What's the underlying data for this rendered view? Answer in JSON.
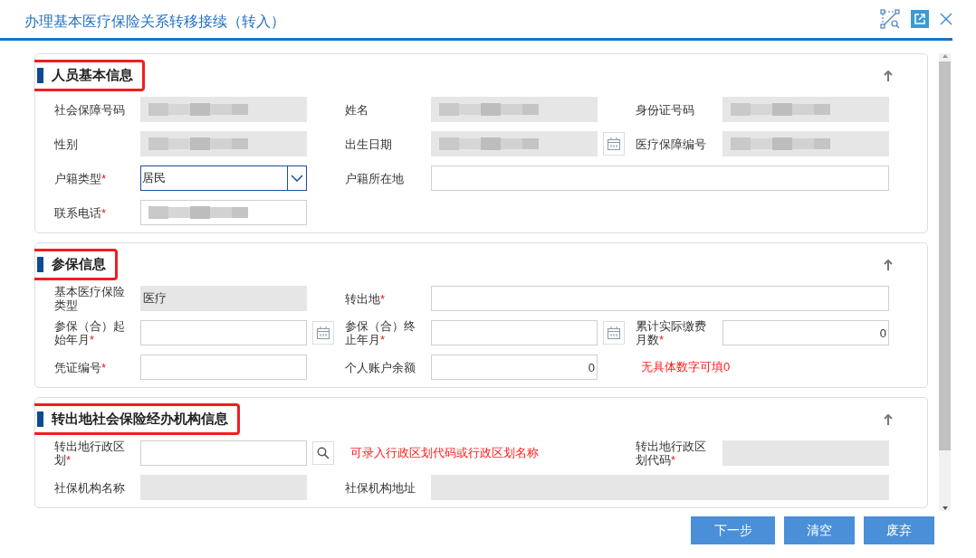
{
  "window": {
    "title": "办理基本医疗保险关系转移接续（转入）"
  },
  "sections": [
    {
      "title": "人员基本信息",
      "highlighted": true,
      "rows": [
        [
          {
            "kind": "label",
            "text": "社会保障号码"
          },
          {
            "kind": "input",
            "readonly": true,
            "redacted": true
          },
          {
            "kind": "spacer"
          },
          {
            "kind": "label",
            "text": "姓名"
          },
          {
            "kind": "input",
            "readonly": true,
            "redacted": true
          },
          {
            "kind": "spacer"
          },
          {
            "kind": "label",
            "text": "身份证号码"
          },
          {
            "kind": "input",
            "readonly": true,
            "redacted": true
          }
        ],
        [
          {
            "kind": "label",
            "text": "性别"
          },
          {
            "kind": "input",
            "readonly": true,
            "redacted": true
          },
          {
            "kind": "spacer"
          },
          {
            "kind": "label",
            "text": "出生日期"
          },
          {
            "kind": "input",
            "readonly": true,
            "redacted": true
          },
          {
            "kind": "calendar"
          },
          {
            "kind": "label",
            "text": "医疗保障编号"
          },
          {
            "kind": "input",
            "readonly": true,
            "redacted": true
          }
        ],
        [
          {
            "kind": "label",
            "text": "户籍类型",
            "star": "*"
          },
          {
            "kind": "select",
            "value": "居民"
          },
          {
            "kind": "spacer"
          },
          {
            "kind": "label",
            "text": "户籍所在地"
          },
          {
            "kind": "wide-input",
            "readonly": false
          }
        ],
        [
          {
            "kind": "label",
            "text": "联系电话",
            "star": "*"
          },
          {
            "kind": "input",
            "readonly": false,
            "redacted": true
          }
        ]
      ]
    },
    {
      "title": "参保信息",
      "highlighted": true,
      "rows": [
        [
          {
            "kind": "label",
            "text": "基本医疗保险类型"
          },
          {
            "kind": "input",
            "readonly": true,
            "value": "医疗"
          },
          {
            "kind": "spacer"
          },
          {
            "kind": "label",
            "text": "转出地",
            "star": "*"
          },
          {
            "kind": "wide-input",
            "readonly": false
          }
        ],
        [
          {
            "kind": "label",
            "text": "参保（合）起始年月",
            "star": "*"
          },
          {
            "kind": "input",
            "readonly": false
          },
          {
            "kind": "calendar"
          },
          {
            "kind": "label",
            "text": "参保（合）终止年月",
            "star": "*"
          },
          {
            "kind": "input",
            "readonly": false
          },
          {
            "kind": "calendar"
          },
          {
            "kind": "label",
            "text": "累计实际缴费月数",
            "star": "*"
          },
          {
            "kind": "input",
            "readonly": false,
            "value": "0",
            "numeric": true
          }
        ],
        [
          {
            "kind": "label",
            "text": "凭证编号",
            "star": "*"
          },
          {
            "kind": "input",
            "readonly": false
          },
          {
            "kind": "spacer"
          },
          {
            "kind": "label",
            "text": "个人账户余额"
          },
          {
            "kind": "input",
            "readonly": false,
            "value": "0",
            "numeric": true
          },
          {
            "kind": "hint",
            "text": "无具体数字可填0"
          }
        ]
      ]
    },
    {
      "title": "转出地社会保险经办机构信息",
      "highlighted": true,
      "rows": [
        [
          {
            "kind": "label",
            "text": "转出地行政区划",
            "star": "*"
          },
          {
            "kind": "input",
            "readonly": false
          },
          {
            "kind": "search"
          },
          {
            "kind": "hint",
            "text": "可录入行政区划代码或行政区划名称"
          },
          {
            "kind": "spacer"
          },
          {
            "kind": "label",
            "text": "转出地行政区划代码",
            "star": "*"
          },
          {
            "kind": "input",
            "readonly": true
          }
        ],
        [
          {
            "kind": "label",
            "text": "社保机构名称"
          },
          {
            "kind": "input",
            "readonly": true
          },
          {
            "kind": "spacer"
          },
          {
            "kind": "label",
            "text": "社保机构地址"
          },
          {
            "kind": "wide-input",
            "readonly": true
          }
        ]
      ]
    }
  ],
  "buttons": [
    "下一步",
    "清空",
    "废弃"
  ]
}
